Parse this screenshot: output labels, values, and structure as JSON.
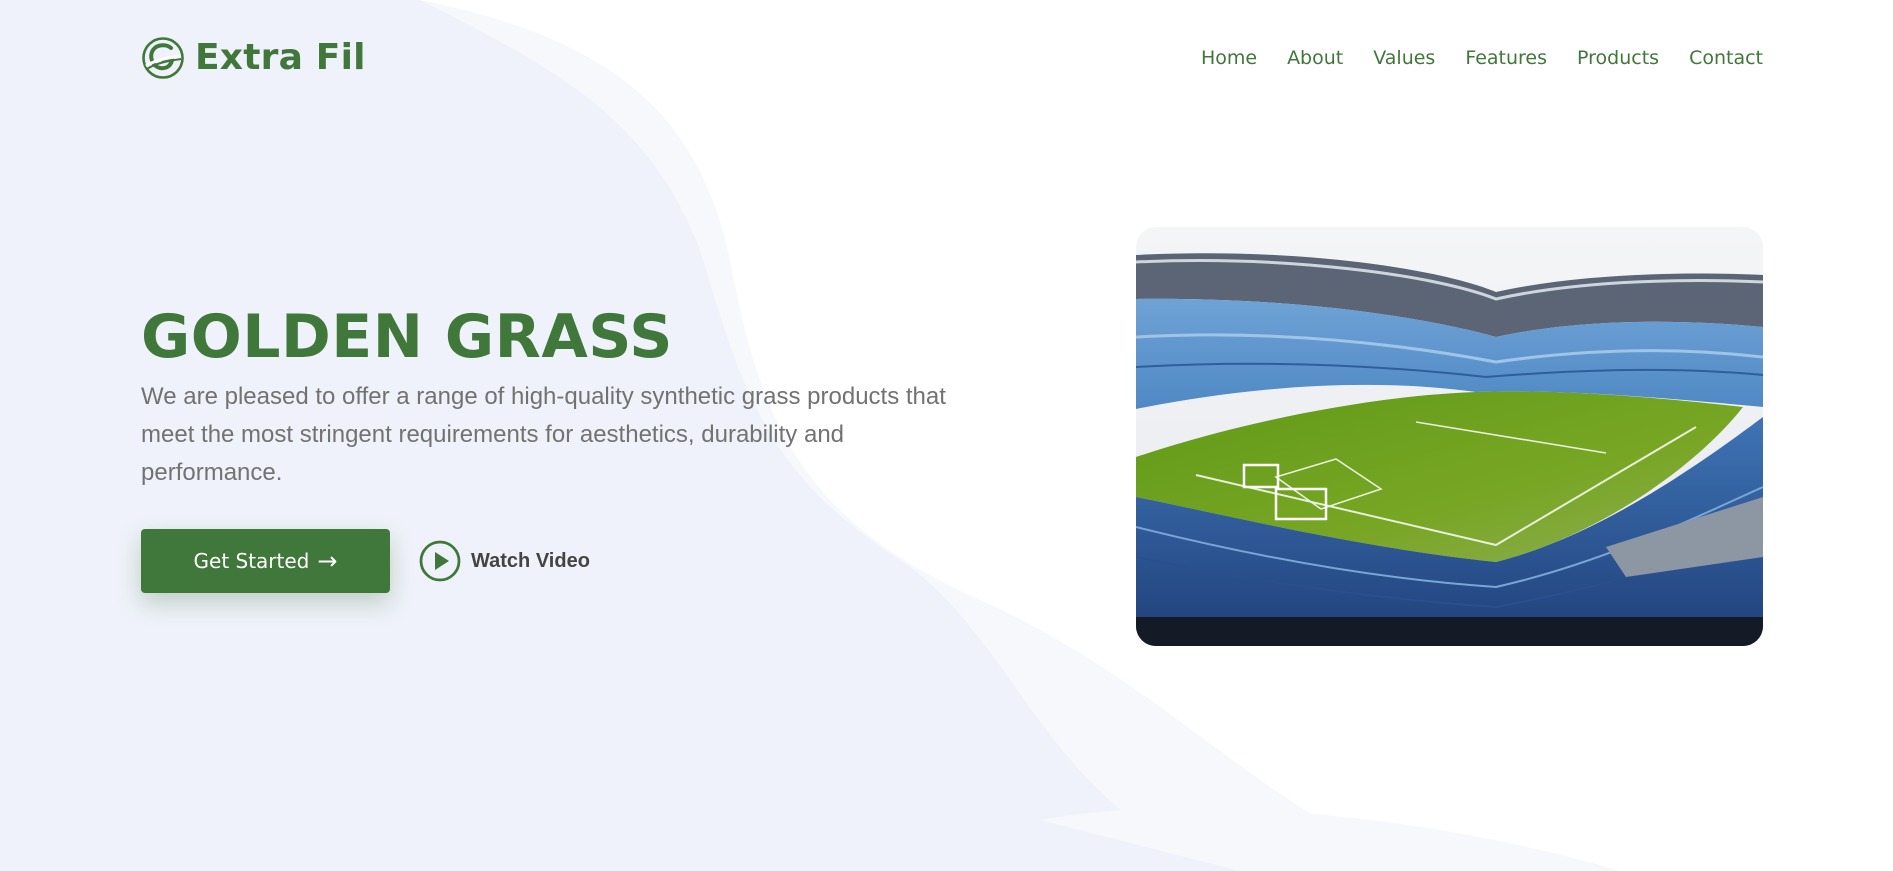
{
  "brand": {
    "name": "Extra Fil",
    "color": "#40773a"
  },
  "nav": {
    "items": [
      {
        "label": "Home"
      },
      {
        "label": "About"
      },
      {
        "label": "Values"
      },
      {
        "label": "Features"
      },
      {
        "label": "Products"
      },
      {
        "label": "Contact"
      }
    ]
  },
  "hero": {
    "title": "GOLDEN GRASS",
    "description": "We are pleased to offer a range of high-quality synthetic grass products that meet the most stringent requirements for aesthetics, durability and performance.",
    "cta_label": "Get Started",
    "cta_icon": "arrow-right-icon",
    "watch_label": "Watch Video",
    "watch_icon": "play-circle-icon",
    "image": "football-stadium-photo"
  },
  "colors": {
    "accent": "#40773a",
    "background_wave": "#eff2fa",
    "text_muted": "#727272"
  }
}
